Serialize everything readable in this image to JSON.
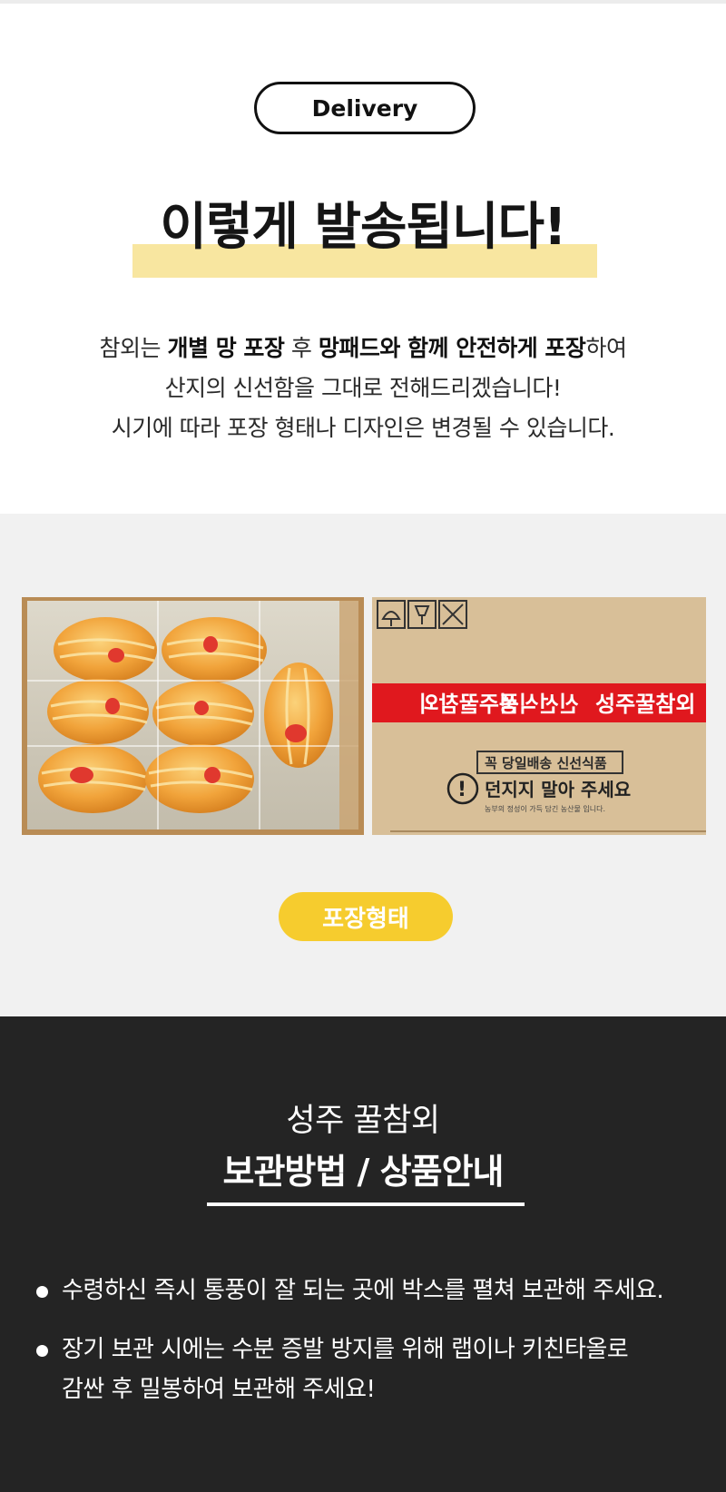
{
  "delivery": {
    "badge_label": "Delivery",
    "headline": "이렇게 발송됩니다!",
    "desc": {
      "l1_a": "참외는 ",
      "l1_b": "개별 망 포장",
      "l1_c": " 후 ",
      "l1_d": "망패드와 함께 안전하게 포장",
      "l1_e": "하여",
      "l2": "산지의 신선함을 그대로 전해드리겠습니다!",
      "l3": "시기에 따라 포장 형태나 디자인은 변경될 수 있습니다."
    }
  },
  "packaging": {
    "box_tape_text": "성주꿀참외",
    "box_tape_text2": "신선식품",
    "box_label_line1": "꼭 당일배송 신선식품",
    "box_label_line2": "던지지 말아 주세요",
    "box_label_line3": "농부의 정성이 가득 담긴 농산물 입니다.",
    "button_label": "포장형태"
  },
  "storage": {
    "subtitle": "성주 꿀참외",
    "title": "보관방법 / 상품안내",
    "bullets": [
      "수령하신 즉시 통풍이 잘 되는 곳에 박스를 펼쳐 보관해 주세요.",
      "장기 보관 시에는 수분 증발 방지를 위해 랩이나 키친타올로",
      "감싼 후 밀봉하여 보관해 주세요!"
    ]
  },
  "colors": {
    "highlight": "#f8e6a0",
    "button_yellow": "#f6cc2e",
    "dark_bg": "#242424",
    "tape_red": "#e0181e"
  }
}
